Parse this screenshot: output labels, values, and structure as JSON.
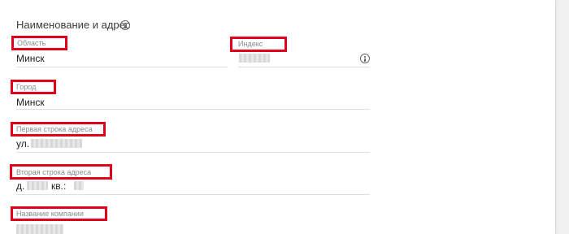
{
  "section": {
    "title": "Наименование и адрес"
  },
  "fields": {
    "region": {
      "label": "Область",
      "value": "Минск"
    },
    "index": {
      "label": "Индекс",
      "value": ""
    },
    "city": {
      "label": "Город",
      "value": "Минск"
    },
    "address1": {
      "label": "Первая строка адреса",
      "value": "ул."
    },
    "address2": {
      "label": "Вторая строка адреса",
      "value_prefix": "д.",
      "value_mid": "кв.:"
    },
    "company": {
      "label": "Название компании",
      "value": ""
    }
  },
  "colors": {
    "highlight": "#e0001b",
    "label": "#8a8a8a",
    "value": "#222222",
    "underline": "#dedede"
  },
  "icons": {
    "section_info": "info-icon",
    "index_info": "info-icon"
  }
}
